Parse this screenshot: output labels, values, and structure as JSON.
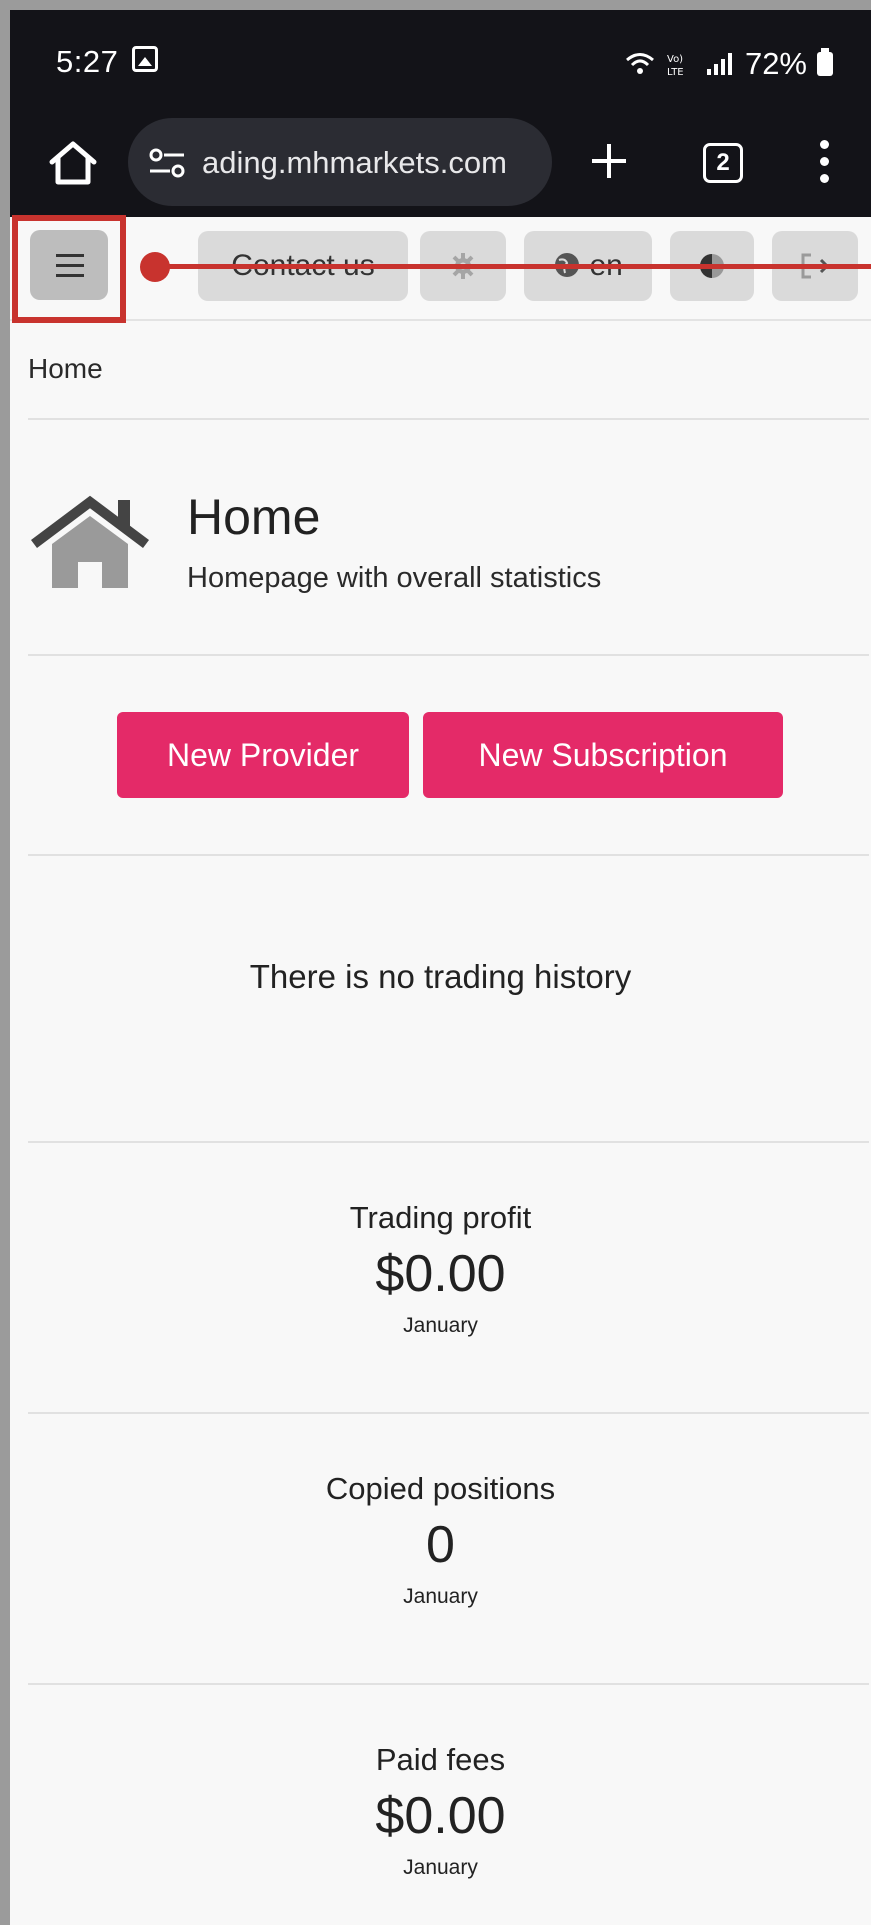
{
  "status_bar": {
    "time": "5:27",
    "battery": "72%",
    "icons": [
      "image-icon",
      "wifi-icon",
      "volte-icon",
      "signal-icon",
      "battery-icon"
    ]
  },
  "browser": {
    "url": "ading.mhmarkets.com",
    "tab_count": "2",
    "icons": [
      "home-icon",
      "site-settings-icon",
      "plus-icon",
      "tabs-icon",
      "kebab-menu-icon"
    ]
  },
  "topbar": {
    "contact_label": "Contact us",
    "language_label": "en",
    "icons": [
      "hamburger-icon",
      "gear-icon",
      "globe-icon",
      "contrast-icon",
      "logout-icon"
    ],
    "highlight_color": "#c8332e"
  },
  "breadcrumb": "Home",
  "header": {
    "title": "Home",
    "subtitle": "Homepage with overall statistics",
    "icon": "house-icon"
  },
  "actions": {
    "new_provider": "New Provider",
    "new_subscription": "New Subscription",
    "accent_color": "#e42a68"
  },
  "empty_message": "There is no trading history",
  "stats": [
    {
      "label": "Trading profit",
      "value": "$0.00",
      "period": "January"
    },
    {
      "label": "Copied positions",
      "value": "0",
      "period": "January"
    },
    {
      "label": "Paid fees",
      "value": "$0.00",
      "period": "January"
    }
  ]
}
